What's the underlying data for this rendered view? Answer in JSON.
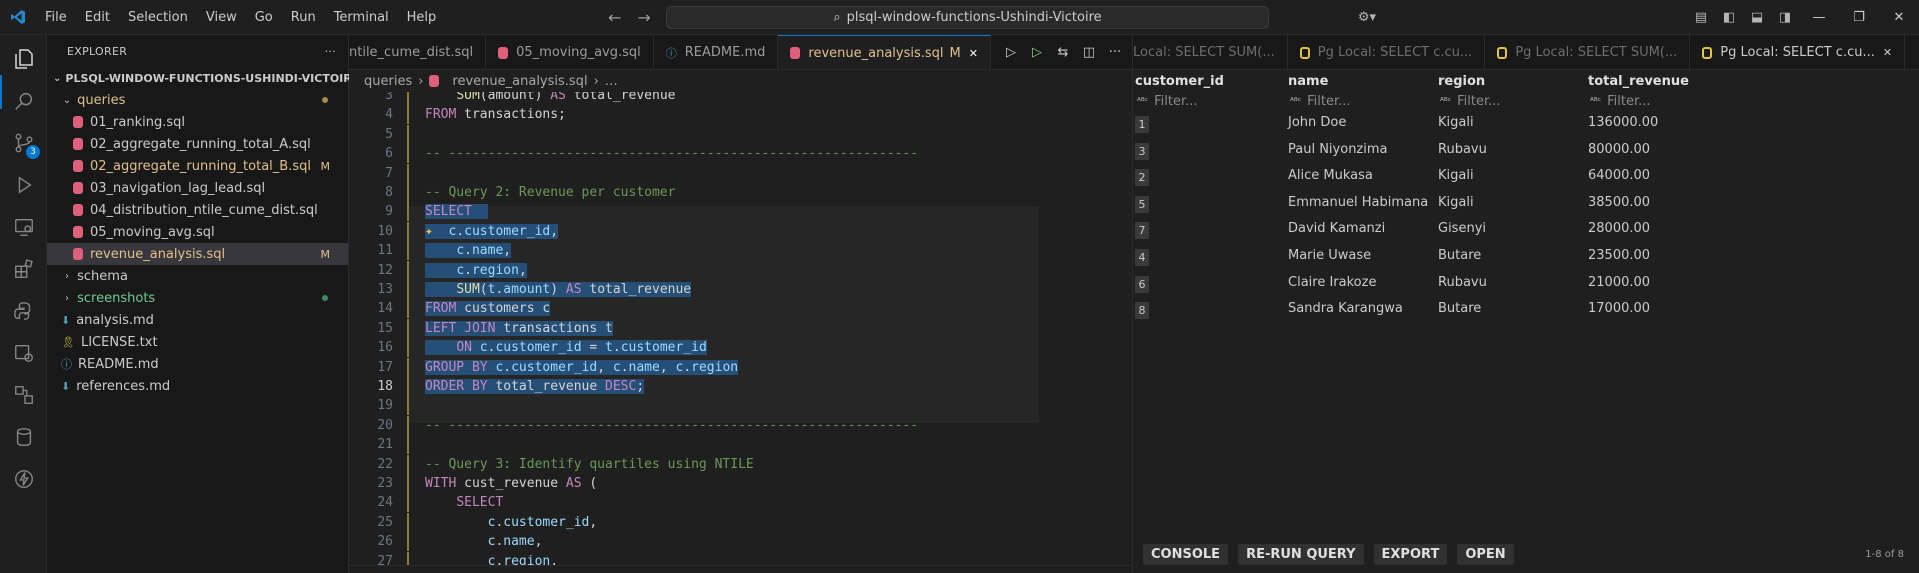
{
  "titlebar": {
    "menu": [
      "File",
      "Edit",
      "Selection",
      "View",
      "Go",
      "Run",
      "Terminal",
      "Help"
    ],
    "search_text": "plsql-window-functions-Ushindi-Victoire"
  },
  "activity": {
    "scm_badge": "3"
  },
  "sidebar": {
    "header": "EXPLORER",
    "root": "PLSQL-WINDOW-FUNCTIONS-USHINDI-VICTOIRE",
    "items": [
      {
        "label": "queries",
        "kind": "folder-open",
        "indent": 1,
        "status": "yellow-dot"
      },
      {
        "label": "01_ranking.sql",
        "kind": "sql",
        "indent": 2
      },
      {
        "label": "02_aggregate_running_total_A.sql",
        "kind": "sql",
        "indent": 2
      },
      {
        "label": "02_aggregate_running_total_B.sql",
        "kind": "sql",
        "indent": 2,
        "status": "M"
      },
      {
        "label": "03_navigation_lag_lead.sql",
        "kind": "sql",
        "indent": 2
      },
      {
        "label": "04_distribution_ntile_cume_dist.sql",
        "kind": "sql",
        "indent": 2
      },
      {
        "label": "05_moving_avg.sql",
        "kind": "sql",
        "indent": 2
      },
      {
        "label": "revenue_analysis.sql",
        "kind": "sql",
        "indent": 2,
        "status": "M",
        "selected": true
      },
      {
        "label": "schema",
        "kind": "folder",
        "indent": 1
      },
      {
        "label": "screenshots",
        "kind": "folder",
        "indent": 1,
        "status": "green-dot"
      },
      {
        "label": "analysis.md",
        "kind": "md",
        "indent": 1
      },
      {
        "label": "LICENSE.txt",
        "kind": "license",
        "indent": 1
      },
      {
        "label": "README.md",
        "kind": "info",
        "indent": 1
      },
      {
        "label": "references.md",
        "kind": "md",
        "indent": 1
      }
    ]
  },
  "editor": {
    "tabs": [
      {
        "label": "ntile_cume_dist.sql",
        "icon": "none"
      },
      {
        "label": "05_moving_avg.sql",
        "icon": "sql"
      },
      {
        "label": "README.md",
        "icon": "info"
      },
      {
        "label": "revenue_analysis.sql",
        "icon": "sql",
        "active": true,
        "modified": "M"
      }
    ],
    "breadcrumb": [
      "queries",
      "revenue_analysis.sql",
      "…"
    ],
    "current_line": 18,
    "lines": [
      {
        "n": 3,
        "parts": [
          [
            "plain",
            "    "
          ],
          [
            "fn",
            "SUM"
          ],
          [
            "plain",
            "(amount) "
          ],
          [
            "kw",
            "AS"
          ],
          [
            "plain",
            " total_revenue"
          ]
        ]
      },
      {
        "n": 4,
        "parts": [
          [
            "kw",
            "FROM"
          ],
          [
            "plain",
            " transactions;"
          ]
        ]
      },
      {
        "n": 5,
        "parts": []
      },
      {
        "n": 6,
        "parts": [
          [
            "cm",
            "-- ------------------------------------------------------------"
          ]
        ]
      },
      {
        "n": 7,
        "parts": []
      },
      {
        "n": 8,
        "parts": [
          [
            "cm",
            "-- Query 2: Revenue per customer"
          ]
        ]
      },
      {
        "n": 9,
        "sel": true,
        "parts": [
          [
            "kw",
            "SELECT"
          ],
          [
            "plain",
            "  "
          ]
        ]
      },
      {
        "n": 10,
        "sel": true,
        "parts": [
          [
            "spark",
            "✦"
          ],
          [
            "plain",
            "  "
          ],
          [
            "id",
            "c"
          ],
          [
            "plain",
            "."
          ],
          [
            "id",
            "customer_id"
          ],
          [
            "plain",
            ","
          ]
        ]
      },
      {
        "n": 11,
        "sel": true,
        "parts": [
          [
            "plain",
            "    "
          ],
          [
            "id",
            "c"
          ],
          [
            "plain",
            "."
          ],
          [
            "id",
            "name"
          ],
          [
            "plain",
            ","
          ]
        ]
      },
      {
        "n": 12,
        "sel": true,
        "parts": [
          [
            "plain",
            "    "
          ],
          [
            "id",
            "c"
          ],
          [
            "plain",
            "."
          ],
          [
            "id",
            "region"
          ],
          [
            "plain",
            ","
          ]
        ]
      },
      {
        "n": 13,
        "sel": true,
        "parts": [
          [
            "plain",
            "    "
          ],
          [
            "fn",
            "SUM"
          ],
          [
            "plain",
            "("
          ],
          [
            "id",
            "t"
          ],
          [
            "plain",
            "."
          ],
          [
            "id",
            "amount"
          ],
          [
            "plain",
            ") "
          ],
          [
            "kw",
            "AS"
          ],
          [
            "plain",
            " total_revenue"
          ]
        ]
      },
      {
        "n": 14,
        "sel": true,
        "parts": [
          [
            "kw",
            "FROM"
          ],
          [
            "plain",
            " customers c"
          ]
        ]
      },
      {
        "n": 15,
        "sel": true,
        "parts": [
          [
            "kw",
            "LEFT JOIN"
          ],
          [
            "plain",
            " transactions t"
          ]
        ]
      },
      {
        "n": 16,
        "sel": true,
        "parts": [
          [
            "plain",
            "    "
          ],
          [
            "kw",
            "ON"
          ],
          [
            "plain",
            " "
          ],
          [
            "id",
            "c"
          ],
          [
            "plain",
            "."
          ],
          [
            "id",
            "customer_id"
          ],
          [
            "plain",
            " = "
          ],
          [
            "id",
            "t"
          ],
          [
            "plain",
            "."
          ],
          [
            "id",
            "customer_id"
          ]
        ]
      },
      {
        "n": 17,
        "sel": true,
        "parts": [
          [
            "kw",
            "GROUP BY"
          ],
          [
            "plain",
            " "
          ],
          [
            "id",
            "c"
          ],
          [
            "plain",
            "."
          ],
          [
            "id",
            "customer_id"
          ],
          [
            "plain",
            ", "
          ],
          [
            "id",
            "c"
          ],
          [
            "plain",
            "."
          ],
          [
            "id",
            "name"
          ],
          [
            "plain",
            ", "
          ],
          [
            "id",
            "c"
          ],
          [
            "plain",
            "."
          ],
          [
            "id",
            "region"
          ]
        ]
      },
      {
        "n": 18,
        "sel": true,
        "parts": [
          [
            "kw",
            "ORDER BY"
          ],
          [
            "plain",
            " total_revenue "
          ],
          [
            "kw",
            "DESC"
          ],
          [
            "plain",
            ";"
          ]
        ]
      },
      {
        "n": 19,
        "parts": []
      },
      {
        "n": 20,
        "parts": [
          [
            "cm",
            "-- ------------------------------------------------------------"
          ]
        ]
      },
      {
        "n": 21,
        "parts": []
      },
      {
        "n": 22,
        "parts": [
          [
            "cm",
            "-- Query 3: Identify quartiles using NTILE"
          ]
        ]
      },
      {
        "n": 23,
        "parts": [
          [
            "kw",
            "WITH"
          ],
          [
            "plain",
            " cust_revenue "
          ],
          [
            "kw",
            "AS"
          ],
          [
            "plain",
            " ("
          ]
        ]
      },
      {
        "n": 24,
        "parts": [
          [
            "plain",
            "    "
          ],
          [
            "kw",
            "SELECT"
          ]
        ]
      },
      {
        "n": 25,
        "parts": [
          [
            "plain",
            "        "
          ],
          [
            "id",
            "c"
          ],
          [
            "plain",
            "."
          ],
          [
            "id",
            "customer_id"
          ],
          [
            "plain",
            ","
          ]
        ]
      },
      {
        "n": 26,
        "parts": [
          [
            "plain",
            "        "
          ],
          [
            "id",
            "c"
          ],
          [
            "plain",
            "."
          ],
          [
            "id",
            "name"
          ],
          [
            "plain",
            ","
          ]
        ]
      },
      {
        "n": 27,
        "parts": [
          [
            "plain",
            "        "
          ],
          [
            "id",
            "c"
          ],
          [
            "plain",
            "."
          ],
          [
            "id",
            "region"
          ],
          [
            "plain",
            ","
          ]
        ]
      }
    ]
  },
  "results": {
    "tabs": [
      {
        "label": "Local: SELECT SUM(...",
        "icon": "none"
      },
      {
        "label": "Pg Local: SELECT c.cu...",
        "icon": "pg"
      },
      {
        "label": "Pg Local: SELECT SUM(...",
        "icon": "pg"
      },
      {
        "label": "Pg Local: SELECT c.cu...",
        "icon": "pg",
        "active": true
      }
    ],
    "columns": [
      "customer_id",
      "name",
      "region",
      "total_revenue"
    ],
    "filter_placeholder": "Filter...",
    "rows": [
      {
        "customer_id": "1",
        "name": "John Doe",
        "region": "Kigali",
        "total_revenue": "136000.00"
      },
      {
        "customer_id": "3",
        "name": "Paul Niyonzima",
        "region": "Rubavu",
        "total_revenue": "80000.00"
      },
      {
        "customer_id": "2",
        "name": "Alice Mukasa",
        "region": "Kigali",
        "total_revenue": "64000.00"
      },
      {
        "customer_id": "5",
        "name": "Emmanuel Habimana",
        "region": "Kigali",
        "total_revenue": "38500.00"
      },
      {
        "customer_id": "7",
        "name": "David Kamanzi",
        "region": "Gisenyi",
        "total_revenue": "28000.00"
      },
      {
        "customer_id": "4",
        "name": "Marie Uwase",
        "region": "Butare",
        "total_revenue": "23500.00"
      },
      {
        "customer_id": "6",
        "name": "Claire Irakoze",
        "region": "Rubavu",
        "total_revenue": "21000.00"
      },
      {
        "customer_id": "8",
        "name": "Sandra Karangwa",
        "region": "Butare",
        "total_revenue": "17000.00"
      }
    ],
    "buttons": [
      "CONSOLE",
      "RE-RUN QUERY",
      "EXPORT",
      "OPEN"
    ],
    "row_count": "1-8 of 8"
  },
  "colors": {
    "accent": "#0078d4",
    "selection": "#264f78",
    "modified": "#e2c08d",
    "sql_icon": "#e05f7a"
  }
}
